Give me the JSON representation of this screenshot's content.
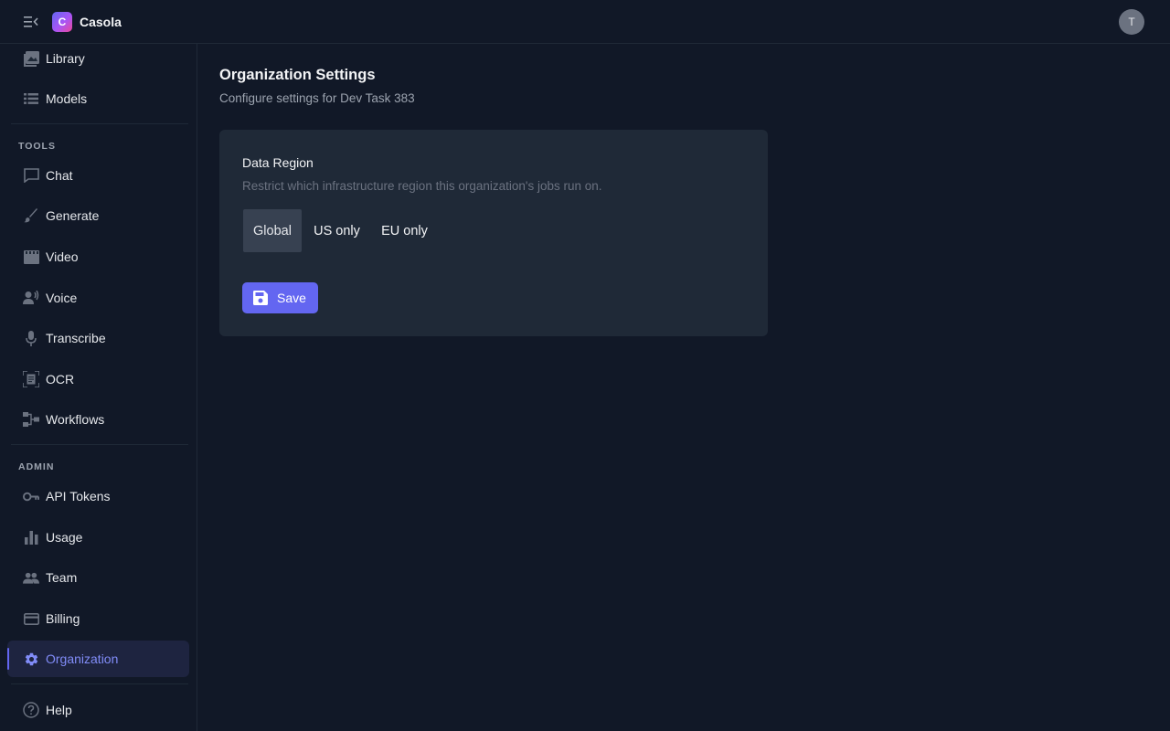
{
  "app": {
    "name": "Casola",
    "logo_letter": "C",
    "user_initial": "T"
  },
  "sidebar": {
    "top_items": [
      {
        "label": "Library",
        "icon": "image-icon"
      },
      {
        "label": "Models",
        "icon": "list-icon"
      }
    ],
    "tools_label": "TOOLS",
    "tools": [
      {
        "label": "Chat",
        "icon": "chat-icon"
      },
      {
        "label": "Generate",
        "icon": "brush-icon"
      },
      {
        "label": "Video",
        "icon": "film-icon"
      },
      {
        "label": "Voice",
        "icon": "voice-icon"
      },
      {
        "label": "Transcribe",
        "icon": "microphone-icon"
      },
      {
        "label": "OCR",
        "icon": "document-scan-icon"
      },
      {
        "label": "Workflows",
        "icon": "workflow-icon"
      }
    ],
    "admin_label": "ADMIN",
    "admin": [
      {
        "label": "API Tokens",
        "icon": "key-icon"
      },
      {
        "label": "Usage",
        "icon": "bar-chart-icon"
      },
      {
        "label": "Team",
        "icon": "people-icon"
      },
      {
        "label": "Billing",
        "icon": "credit-card-icon"
      },
      {
        "label": "Organization",
        "icon": "gear-icon",
        "active": true
      }
    ],
    "help": {
      "label": "Help",
      "icon": "help-icon"
    }
  },
  "main": {
    "title": "Organization Settings",
    "subtitle": "Configure settings for Dev Task 383",
    "setting": {
      "title": "Data Region",
      "description": "Restrict which infrastructure region this organization's jobs run on.",
      "options": [
        "Global",
        "US only",
        "EU only"
      ],
      "selected": "Global"
    },
    "save_label": "Save"
  },
  "colors": {
    "accent": "#6366f1",
    "background": "#111827",
    "card": "#1f2937"
  }
}
